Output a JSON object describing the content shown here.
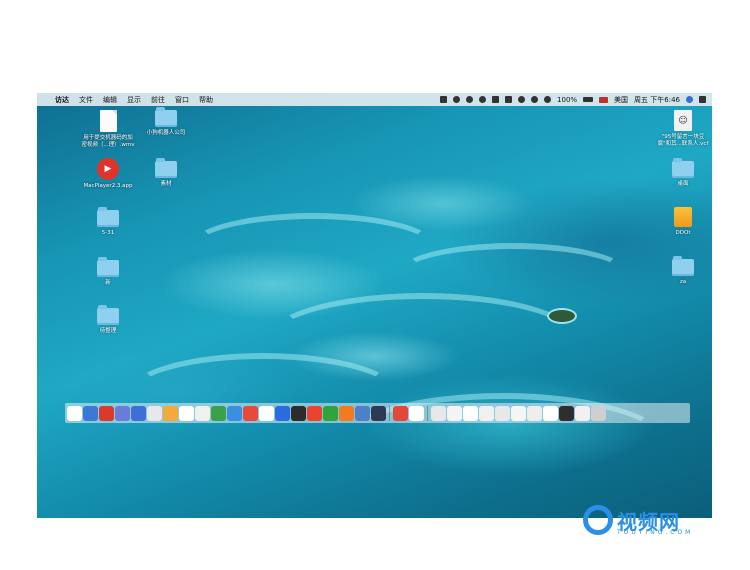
{
  "menubar": {
    "apple": "",
    "items": [
      "访达",
      "文件",
      "编辑",
      "显示",
      "前往",
      "窗口",
      "帮助"
    ],
    "battery": "100%",
    "input_method": "美国",
    "clock": "周五 下午6:46"
  },
  "desktop": {
    "left_icons": [
      {
        "label": "用于提交机器码的加\n密视频（...理）.wmv",
        "kind": "doc"
      },
      {
        "label": "小狗机器人公司",
        "kind": "folder"
      },
      {
        "label": "MacPlayer2.3.app",
        "kind": "app"
      },
      {
        "label": "素材",
        "kind": "folder"
      },
      {
        "label": "5-31",
        "kind": "folder"
      },
      {
        "label": "新",
        "kind": "folder"
      },
      {
        "label": "待整理",
        "kind": "folder"
      }
    ],
    "right_icons": [
      {
        "label": "\"95号留言一块豆\n腐\"和其...联系人.vcf",
        "kind": "contact"
      },
      {
        "label": "桌面",
        "kind": "folder"
      },
      {
        "label": "DDOt",
        "kind": "drive"
      },
      {
        "label": "za",
        "kind": "folder"
      }
    ]
  },
  "dock": {
    "colors": [
      "#ffffff",
      "#3a7ad6",
      "#d83a2f",
      "#6b7bd8",
      "#3d6fd6",
      "#e8e8e8",
      "#f4a93b",
      "#ffffff",
      "#f0f0f0",
      "#3aa14b",
      "#3b8fe0",
      "#e64a3d",
      "#ffffff",
      "#2b6be0",
      "#2c2c2c",
      "#e8442f",
      "#2fa33c",
      "#f27a1f",
      "#4f7fc6",
      "#2d3a56",
      "#e0493a",
      "#ffffff",
      "#e8e8e8",
      "#f4f4f4",
      "#ffffff",
      "#f0f0f0",
      "#e8e8e8",
      "#f5f5f5",
      "#eeeeee",
      "#ffffff",
      "#2e2e2e",
      "#f1f1f1",
      "#cfcfcf"
    ]
  },
  "watermark": {
    "text": "视频网",
    "sub": "TOUTING.COM"
  },
  "colors": {
    "accent": "#2b8fe6",
    "desktop": "#1795b4"
  }
}
